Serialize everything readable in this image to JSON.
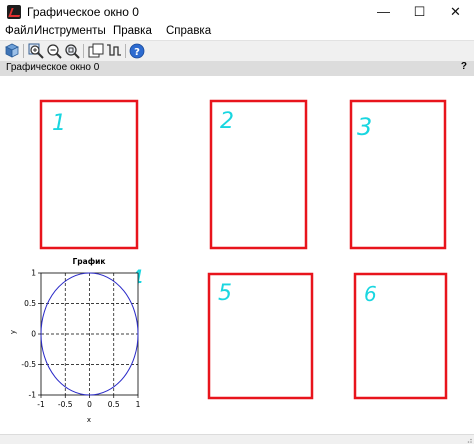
{
  "window": {
    "title": "Графическое окно 0",
    "icon": "scilab-graphics-icon",
    "controls": {
      "minimize": "—",
      "maximize": "☐",
      "close": "✕"
    }
  },
  "menu": {
    "file": "Файл",
    "tools": "Инструменты",
    "edit": "Правка",
    "help": "Справка"
  },
  "toolbar": {
    "buttons": [
      "rotate-3d-icon",
      "zoom-in-icon",
      "zoom-out-icon",
      "zoom-original-icon",
      "select-figure-icon",
      "datatip-icon",
      "help-icon"
    ]
  },
  "panel": {
    "title": "Графическое окно 0",
    "help": "?"
  },
  "annotations": {
    "box1": "1",
    "box2": "2",
    "box3": "3",
    "box4": "4",
    "box5": "5",
    "box6": "6",
    "box_color": "#e8141c",
    "number_color": "#19d6e0"
  },
  "chart_data": {
    "type": "line",
    "title": "График",
    "xlabel": "x",
    "ylabel": "y",
    "xlim": [
      -1,
      1
    ],
    "ylim": [
      -1,
      1
    ],
    "x_ticks": [
      "-1",
      "-0.5",
      "0",
      "0.5",
      "1"
    ],
    "y_ticks": [
      "1",
      "0.5",
      "0",
      "-0.5",
      "-1"
    ],
    "grid": true,
    "series": [
      {
        "shape": "circle",
        "center": [
          0,
          0
        ],
        "radius": 1,
        "color": "#2a2ac8"
      }
    ]
  }
}
